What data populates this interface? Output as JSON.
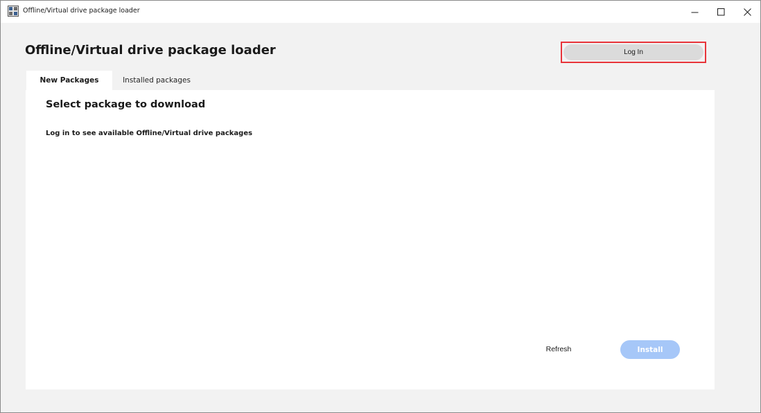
{
  "window": {
    "title": "Offline/Virtual drive package loader",
    "icon": "app-icon",
    "controls": [
      "minimize-icon",
      "maximize-icon",
      "close-icon"
    ]
  },
  "header": {
    "title": "Offline/Virtual drive package loader",
    "login_label": "Log In"
  },
  "tabs": [
    {
      "label": "New Packages",
      "active": true
    },
    {
      "label": "Installed packages",
      "active": false
    }
  ],
  "main": {
    "heading": "Select package to download",
    "message": "Log in to see available Offline/Virtual drive packages",
    "refresh_label": "Refresh",
    "install_label": "Install",
    "install_enabled": false
  },
  "colors": {
    "highlight_border": "#e8343a",
    "install_disabled_bg": "#a6c7f8",
    "login_bg": "#dbdbdb",
    "panel_bg": "#ffffff",
    "window_bg": "#f2f2f2"
  }
}
